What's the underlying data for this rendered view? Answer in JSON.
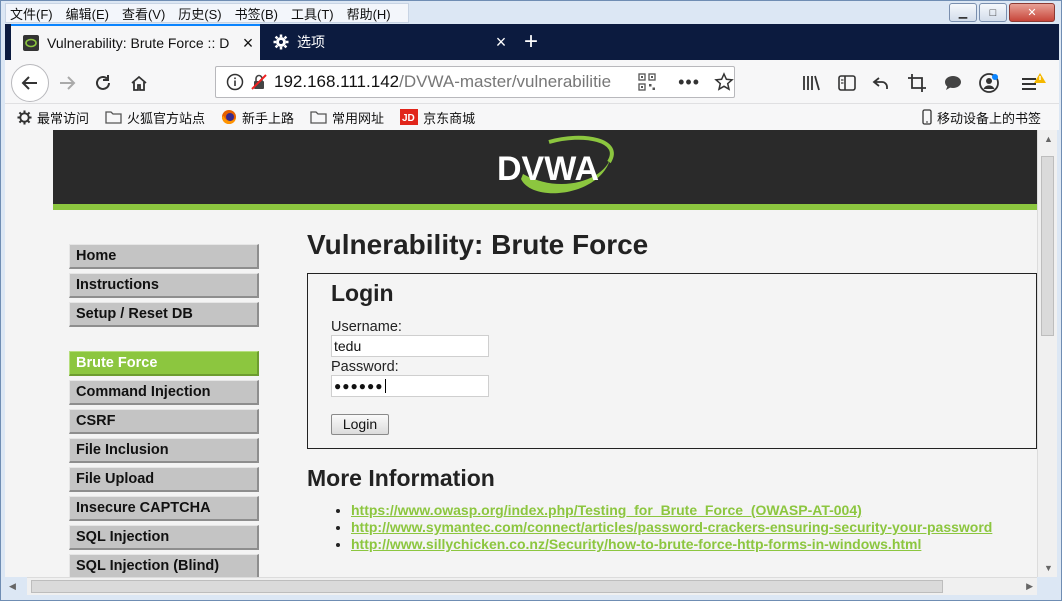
{
  "menubar": {
    "items": [
      "文件(F)",
      "编辑(E)",
      "查看(V)",
      "历史(S)",
      "书签(B)",
      "工具(T)",
      "帮助(H)"
    ]
  },
  "tabs": [
    {
      "title": "Vulnerability: Brute Force :: D",
      "active": true
    },
    {
      "title": "选项",
      "active": false
    }
  ],
  "toolbar": {
    "url_host": "192.168.111.142",
    "url_path": "/DVWA-master/vulnerabilitie"
  },
  "bookmarks": {
    "items": [
      "最常访问",
      "火狐官方站点",
      "新手上路",
      "常用网址",
      "京东商城"
    ],
    "mobile": "移动设备上的书签"
  },
  "site": {
    "logo_text": "DVWA",
    "accent": "#8cc63f",
    "menu_group1": [
      "Home",
      "Instructions",
      "Setup / Reset DB"
    ],
    "menu_group2": [
      "Brute Force",
      "Command Injection",
      "CSRF",
      "File Inclusion",
      "File Upload",
      "Insecure CAPTCHA",
      "SQL Injection",
      "SQL Injection (Blind)"
    ],
    "selected": "Brute Force"
  },
  "main": {
    "title": "Vulnerability: Brute Force",
    "login_heading": "Login",
    "username_label": "Username:",
    "username_value": "tedu",
    "password_label": "Password:",
    "password_mask": "●●●●●●",
    "login_button": "Login",
    "more_heading": "More Information",
    "links": [
      "https://www.owasp.org/index.php/Testing_for_Brute_Force_(OWASP-AT-004)",
      "http://www.symantec.com/connect/articles/password-crackers-ensuring-security-your-password",
      "http://www.sillychicken.co.nz/Security/how-to-brute-force-http-forms-in-windows.html"
    ]
  }
}
